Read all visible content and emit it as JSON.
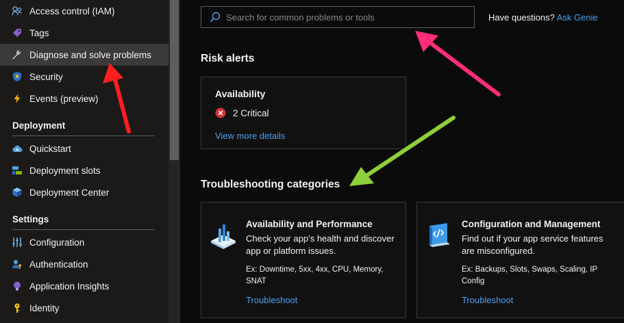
{
  "sidebar": {
    "items": [
      {
        "label": "Access control (IAM)",
        "icon": "people-icon"
      },
      {
        "label": "Tags",
        "icon": "tag-icon"
      },
      {
        "label": "Diagnose and solve problems",
        "icon": "wrench-icon",
        "active": true
      },
      {
        "label": "Security",
        "icon": "shield-icon"
      },
      {
        "label": "Events (preview)",
        "icon": "lightning-icon"
      }
    ],
    "sections": [
      {
        "title": "Deployment",
        "items": [
          {
            "label": "Quickstart",
            "icon": "cloud-icon"
          },
          {
            "label": "Deployment slots",
            "icon": "slots-icon"
          },
          {
            "label": "Deployment Center",
            "icon": "cube-icon"
          }
        ]
      },
      {
        "title": "Settings",
        "items": [
          {
            "label": "Configuration",
            "icon": "sliders-icon"
          },
          {
            "label": "Authentication",
            "icon": "person-key-icon"
          },
          {
            "label": "Application Insights",
            "icon": "lightbulb-icon"
          },
          {
            "label": "Identity",
            "icon": "key-icon"
          }
        ]
      }
    ]
  },
  "search": {
    "placeholder": "Search for common problems or tools",
    "value": ""
  },
  "help": {
    "question": "Have questions?",
    "link": "Ask Genie"
  },
  "risk_alerts": {
    "heading": "Risk alerts",
    "card": {
      "title": "Availability",
      "status": "2 Critical",
      "status_icon": "error-circle-icon",
      "link": "View more details"
    }
  },
  "troubleshooting": {
    "heading": "Troubleshooting categories",
    "cards": [
      {
        "title": "Availability and Performance",
        "description": "Check your app’s health and discover app or platform issues.",
        "examples": "Ex: Downtime, 5xx, 4xx, CPU, Memory, SNAT",
        "link": "Troubleshoot",
        "icon": "bar-chart-icon"
      },
      {
        "title": "Configuration and Management",
        "description": "Find out if your app service features are misconfigured.",
        "examples": "Ex: Backups, Slots, Swaps, Scaling, IP Config",
        "link": "Troubleshoot",
        "icon": "config-code-icon"
      }
    ]
  },
  "colors": {
    "accent_link": "#4aa0f0",
    "pink_arrow": "#ff2d7a",
    "red_arrow": "#ff1f1f",
    "green_arrow": "#8ecf3a"
  }
}
